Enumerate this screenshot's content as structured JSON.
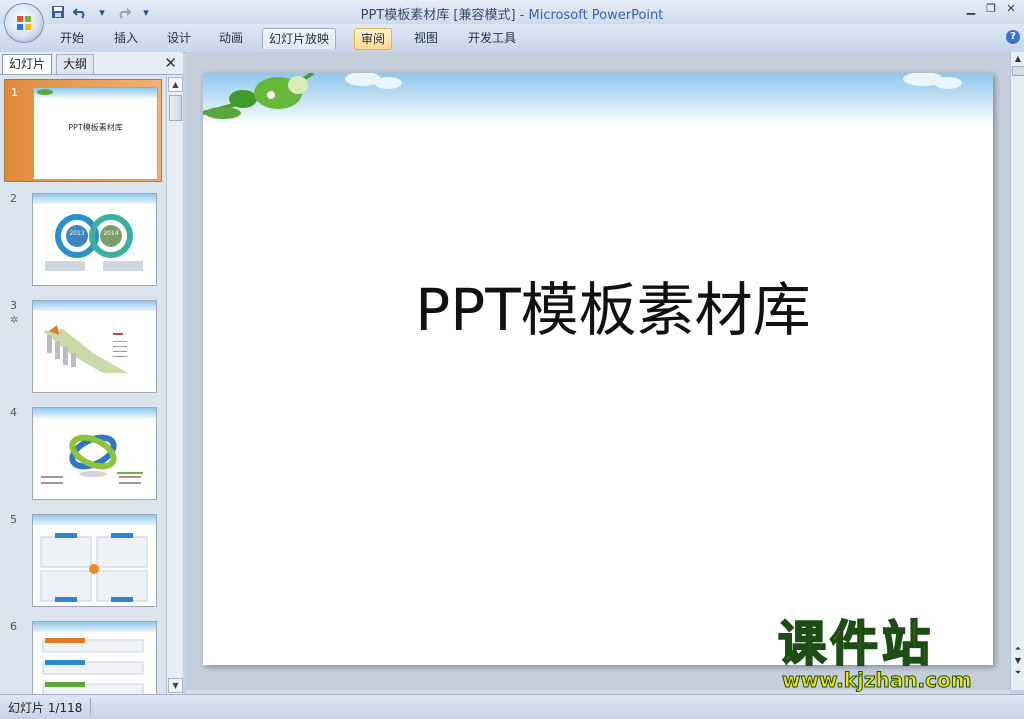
{
  "window": {
    "title": "PPT模板素材库 [兼容模式]",
    "title_sep": " - ",
    "app_name": "Microsoft PowerPoint",
    "controls": {
      "minimize": "▁",
      "restore": "❐",
      "close": "✕"
    }
  },
  "qat": {
    "save_icon": "save-icon",
    "undo_icon": "undo-icon",
    "redo_icon": "redo-icon",
    "customize_icon": "customize-icon"
  },
  "ribbon": {
    "tabs": [
      {
        "label": "开始",
        "state": "normal"
      },
      {
        "label": "插入",
        "state": "normal"
      },
      {
        "label": "设计",
        "state": "normal"
      },
      {
        "label": "动画",
        "state": "normal"
      },
      {
        "label": "幻灯片放映",
        "state": "active"
      },
      {
        "label": "审阅",
        "state": "hot"
      },
      {
        "label": "视图",
        "state": "normal"
      },
      {
        "label": "开发工具",
        "state": "normal"
      }
    ],
    "help": "?"
  },
  "left_pane": {
    "tabs": {
      "slides": "幻灯片",
      "outline": "大纲"
    },
    "close": "✕",
    "thumbnails": [
      {
        "number": "1",
        "title": "PPT模板素材库",
        "selected": true
      },
      {
        "number": "2"
      },
      {
        "number": "3",
        "has_animation": true
      },
      {
        "number": "4"
      },
      {
        "number": "5"
      },
      {
        "number": "6"
      }
    ],
    "thumb_2_years": [
      "2013",
      "2014"
    ]
  },
  "slide": {
    "title": "PPT模板素材库"
  },
  "status": {
    "slide_indicator": "幻灯片 1/118"
  },
  "watermark": {
    "big": "课件站",
    "url": "www.kjzhan.com"
  },
  "colors": {
    "accent": "#f0a050",
    "ribbon_blue": "#c6d5e9",
    "watermark_yellow": "#f3df13"
  }
}
